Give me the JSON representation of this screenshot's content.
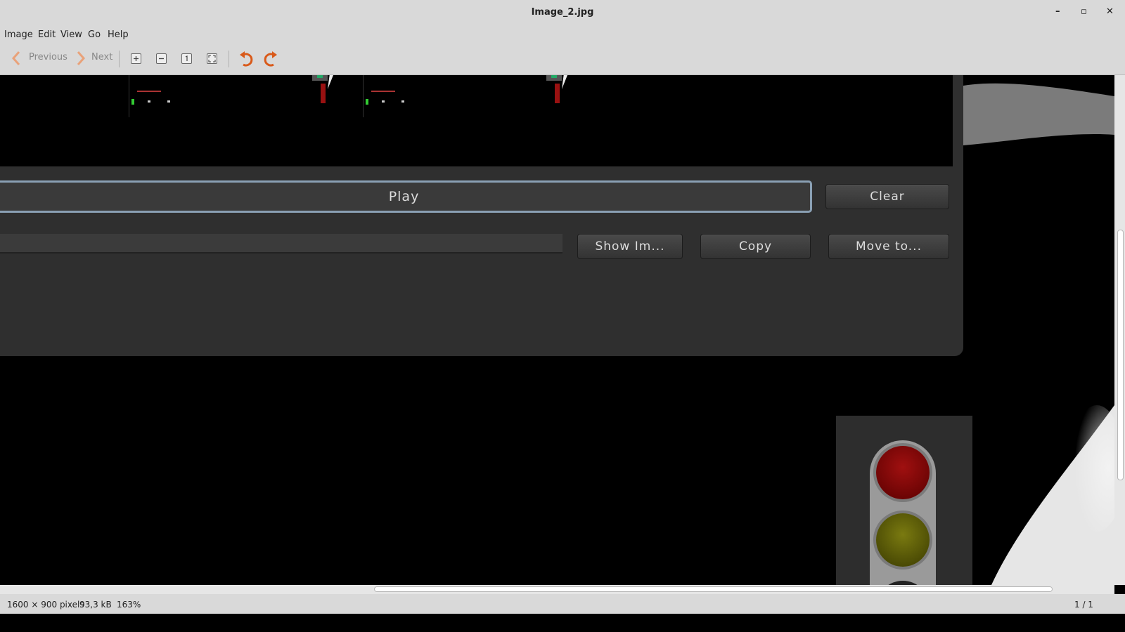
{
  "window": {
    "title": "Image_2.jpg",
    "controls": {
      "minimize": "–",
      "maximize": "▫",
      "close": "✕"
    }
  },
  "menu": [
    "Image",
    "Edit",
    "View",
    "Go",
    "Help"
  ],
  "toolbar": {
    "previous_label": "Previous",
    "next_label": "Next",
    "icons": [
      "zoom-in-icon",
      "zoom-out-icon",
      "zoom-normal-icon",
      "zoom-fit-icon",
      "rotate-left-icon",
      "rotate-right-icon"
    ]
  },
  "image_content": {
    "play_label": "Play",
    "clear_label": "Clear",
    "show_image_label": "Show Im...",
    "copy_label": "Copy",
    "move_to_label": "Move to...",
    "accent_color": "#8aa0b4"
  },
  "status": {
    "dimensions": "1600 × 900 pixels",
    "file_size": "93,3 kB",
    "zoom": "163%",
    "page": "1 / 1"
  }
}
